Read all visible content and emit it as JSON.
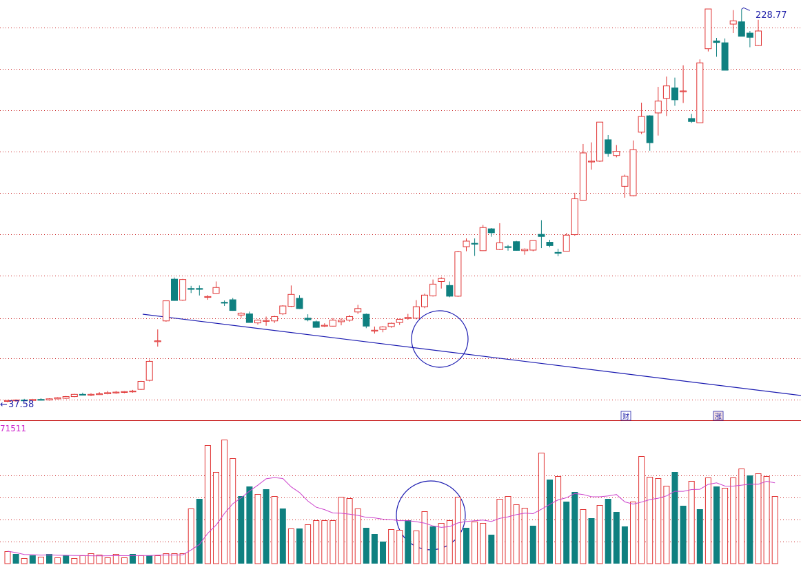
{
  "chart_data": [
    {
      "type": "candlestick",
      "title": "",
      "y_axis_scale": "log",
      "ylim": [
        35,
        240
      ],
      "grid": true,
      "annotations": {
        "high_label": "228.77",
        "low_label": "37.58",
        "low_prefix": "←",
        "markers": [
          "财",
          "涨"
        ],
        "trendline": "descending line drawn across upper consolidation highs, broken upward at the circled candles",
        "circle": "circle around breakout candles"
      },
      "colors": {
        "up": "#e03232",
        "down": "#0f8080",
        "trendline": "#1a1ab0",
        "separator": "#c00000"
      },
      "candles": [
        [
          37.8,
          38.0,
          37.6,
          37.9
        ],
        [
          37.9,
          38.1,
          37.7,
          38.0
        ],
        [
          38.0,
          38.2,
          37.8,
          37.9
        ],
        [
          37.9,
          38.2,
          37.7,
          38.1
        ],
        [
          38.1,
          38.3,
          37.9,
          38.0
        ],
        [
          38.0,
          38.3,
          37.9,
          38.2
        ],
        [
          38.2,
          38.5,
          38.1,
          38.4
        ],
        [
          38.3,
          38.7,
          38.2,
          38.6
        ],
        [
          38.6,
          39.1,
          38.5,
          39.0
        ],
        [
          39.0,
          39.3,
          38.8,
          38.9
        ],
        [
          38.9,
          39.2,
          38.7,
          39.0
        ],
        [
          39.0,
          39.4,
          38.9,
          39.1
        ],
        [
          39.1,
          39.6,
          39.0,
          39.3
        ],
        [
          39.3,
          39.6,
          39.1,
          39.4
        ],
        [
          39.4,
          39.6,
          39.2,
          39.5
        ],
        [
          39.5,
          39.8,
          39.3,
          39.6
        ],
        [
          39.9,
          41.5,
          39.8,
          41.4
        ],
        [
          41.6,
          45.8,
          41.4,
          45.4
        ],
        [
          49.8,
          52.6,
          48.6,
          49.9
        ],
        [
          54.7,
          60.0,
          54.5,
          60.0
        ],
        [
          66.3,
          66.8,
          60.0,
          60.1
        ],
        [
          60.2,
          66.4,
          60.0,
          66.2
        ],
        [
          63.5,
          64.3,
          62.2,
          63.3
        ],
        [
          63.5,
          64.4,
          61.5,
          63.4
        ],
        [
          61.1,
          61.6,
          60.3,
          61.2
        ],
        [
          62.1,
          65.6,
          62.0,
          63.8
        ],
        [
          59.6,
          60.1,
          58.6,
          59.5
        ],
        [
          60.3,
          60.8,
          57.3,
          57.4
        ],
        [
          56.2,
          56.9,
          55.5,
          56.7
        ],
        [
          56.5,
          57.1,
          54.3,
          54.3
        ],
        [
          54.2,
          55.1,
          53.8,
          54.9
        ],
        [
          54.6,
          55.8,
          53.5,
          54.8
        ],
        [
          54.7,
          56.0,
          54.2,
          55.8
        ],
        [
          56.5,
          58.8,
          56.2,
          58.6
        ],
        [
          58.5,
          64.4,
          58.3,
          61.8
        ],
        [
          60.7,
          61.6,
          57.8,
          57.9
        ],
        [
          55.4,
          56.4,
          54.6,
          55.0
        ],
        [
          54.5,
          54.8,
          53.0,
          53.1
        ],
        [
          53.4,
          54.1,
          53.2,
          53.6
        ],
        [
          53.4,
          55.4,
          53.3,
          54.9
        ],
        [
          54.5,
          55.4,
          53.6,
          54.9
        ],
        [
          54.9,
          56.2,
          54.5,
          55.8
        ],
        [
          57.0,
          58.9,
          56.5,
          57.9
        ],
        [
          56.4,
          56.6,
          52.9,
          53.4
        ],
        [
          52.4,
          53.3,
          51.6,
          52.4
        ],
        [
          52.6,
          53.4,
          51.9,
          53.2
        ],
        [
          53.3,
          54.3,
          53.0,
          54.1
        ],
        [
          54.3,
          55.3,
          53.7,
          55.1
        ],
        [
          55.3,
          56.5,
          55.0,
          55.6
        ],
        [
          55.4,
          60.2,
          55.1,
          58.4
        ],
        [
          58.4,
          62.0,
          58.0,
          61.6
        ],
        [
          61.4,
          66.2,
          61.2,
          64.8
        ],
        [
          65.6,
          66.9,
          63.5,
          66.5
        ],
        [
          64.4,
          65.6,
          61.0,
          61.3
        ],
        [
          61.3,
          75.5,
          61.1,
          75.2
        ],
        [
          77.0,
          80.0,
          75.4,
          79.0
        ],
        [
          78.2,
          80.0,
          73.8,
          78.0
        ],
        [
          75.6,
          85.1,
          75.5,
          84.1
        ],
        [
          83.6,
          83.9,
          80.6,
          82.1
        ],
        [
          76.0,
          85.8,
          75.8,
          78.4
        ],
        [
          77.0,
          77.6,
          75.6,
          76.9
        ],
        [
          78.8,
          79.1,
          75.6,
          75.7
        ],
        [
          75.6,
          76.4,
          74.2,
          76.1
        ],
        [
          75.8,
          79.1,
          75.4,
          79.2
        ],
        [
          81.5,
          87.0,
          76.5,
          80.7
        ],
        [
          78.6,
          79.5,
          76.8,
          77.4
        ],
        [
          75.0,
          76.3,
          73.7,
          74.7
        ],
        [
          75.4,
          82.0,
          75.3,
          81.2
        ],
        [
          81.4,
          98.7,
          81.0,
          96.0
        ],
        [
          95.4,
          123.6,
          95.3,
          118.6
        ],
        [
          113.9,
          124.5,
          109.8,
          114.2
        ],
        [
          114.2,
          136.8,
          113.8,
          136.7
        ],
        [
          126.0,
          128.8,
          116.5,
          118.3
        ],
        [
          117.2,
          123.0,
          116.2,
          119.5
        ],
        [
          101.7,
          107.3,
          96.5,
          106.5
        ],
        [
          97.4,
          125.6,
          97.1,
          120.4
        ],
        [
          130.5,
          149.5,
          129.4,
          140.3
        ],
        [
          140.7,
          141.1,
          119.8,
          124.3
        ],
        [
          142.6,
          160.8,
          128.5,
          150.6
        ],
        [
          152.5,
          168.6,
          140.6,
          161.5
        ],
        [
          160.0,
          167.8,
          147.4,
          151.5
        ],
        [
          157.3,
          177.6,
          149.3,
          157.8
        ],
        [
          139.0,
          142.0,
          136.2,
          137.1
        ],
        [
          136.3,
          182.5,
          136.3,
          179.6
        ],
        [
          191.7,
          229.0,
          189.3,
          230.2
        ],
        [
          198.7,
          201.5,
          184.7,
          197.3
        ],
        [
          197.0,
          201.0,
          176.6,
          173.6
        ],
        [
          214.7,
          229.0,
          206.0,
          218.0
        ],
        [
          217.0,
          230.0,
          203.0,
          203.0
        ],
        [
          206.0,
          208.0,
          193.0,
          202.0
        ],
        [
          194.5,
          219.0,
          194.0,
          208.0
        ]
      ],
      "volume": {
        "label": "71511",
        "ma_color": "#cc44cc",
        "bars": [
          [
            18,
            0
          ],
          [
            14,
            1
          ],
          [
            8,
            0
          ],
          [
            12,
            1
          ],
          [
            10,
            0
          ],
          [
            14,
            1
          ],
          [
            9,
            0
          ],
          [
            12,
            1
          ],
          [
            8,
            0
          ],
          [
            12,
            0
          ],
          [
            15,
            0
          ],
          [
            13,
            0
          ],
          [
            9,
            0
          ],
          [
            14,
            0
          ],
          [
            9,
            0
          ],
          [
            14,
            1
          ],
          [
            12,
            0
          ],
          [
            12,
            1
          ],
          [
            12,
            0
          ],
          [
            15,
            0
          ],
          [
            15,
            0
          ],
          [
            15,
            0
          ],
          [
            80,
            0
          ],
          [
            94,
            1
          ],
          [
            172,
            0
          ],
          [
            133,
            0
          ],
          [
            180,
            0
          ],
          [
            153,
            0
          ],
          [
            98,
            1
          ],
          [
            112,
            1
          ],
          [
            101,
            0
          ],
          [
            108,
            1
          ],
          [
            98,
            0
          ],
          [
            80,
            1
          ],
          [
            51,
            0
          ],
          [
            51,
            1
          ],
          [
            57,
            0
          ],
          [
            63,
            0
          ],
          [
            63,
            0
          ],
          [
            63,
            0
          ],
          [
            97,
            0
          ],
          [
            95,
            0
          ],
          [
            80,
            0
          ],
          [
            52,
            1
          ],
          [
            43,
            1
          ],
          [
            32,
            1
          ],
          [
            50,
            0
          ],
          [
            49,
            0
          ],
          [
            63,
            1
          ],
          [
            48,
            0
          ],
          [
            76,
            0
          ],
          [
            54,
            1
          ],
          [
            59,
            0
          ],
          [
            63,
            0
          ],
          [
            97,
            0
          ],
          [
            52,
            1
          ],
          [
            61,
            0
          ],
          [
            59,
            0
          ],
          [
            42,
            1
          ],
          [
            94,
            0
          ],
          [
            98,
            0
          ],
          [
            86,
            0
          ],
          [
            81,
            0
          ],
          [
            55,
            1
          ],
          [
            161,
            0
          ],
          [
            122,
            1
          ],
          [
            127,
            0
          ],
          [
            90,
            1
          ],
          [
            104,
            1
          ],
          [
            79,
            0
          ],
          [
            66,
            1
          ],
          [
            85,
            0
          ],
          [
            94,
            1
          ],
          [
            75,
            1
          ],
          [
            54,
            1
          ],
          [
            90,
            0
          ],
          [
            156,
            0
          ],
          [
            126,
            0
          ],
          [
            124,
            0
          ],
          [
            113,
            0
          ],
          [
            133,
            1
          ],
          [
            84,
            1
          ],
          [
            120,
            0
          ],
          [
            79,
            1
          ],
          [
            125,
            0
          ],
          [
            112,
            1
          ],
          [
            110,
            0
          ],
          [
            125,
            0
          ],
          [
            138,
            0
          ],
          [
            128,
            1
          ],
          [
            131,
            0
          ],
          [
            127,
            0
          ],
          [
            98,
            0
          ]
        ]
      }
    }
  ]
}
